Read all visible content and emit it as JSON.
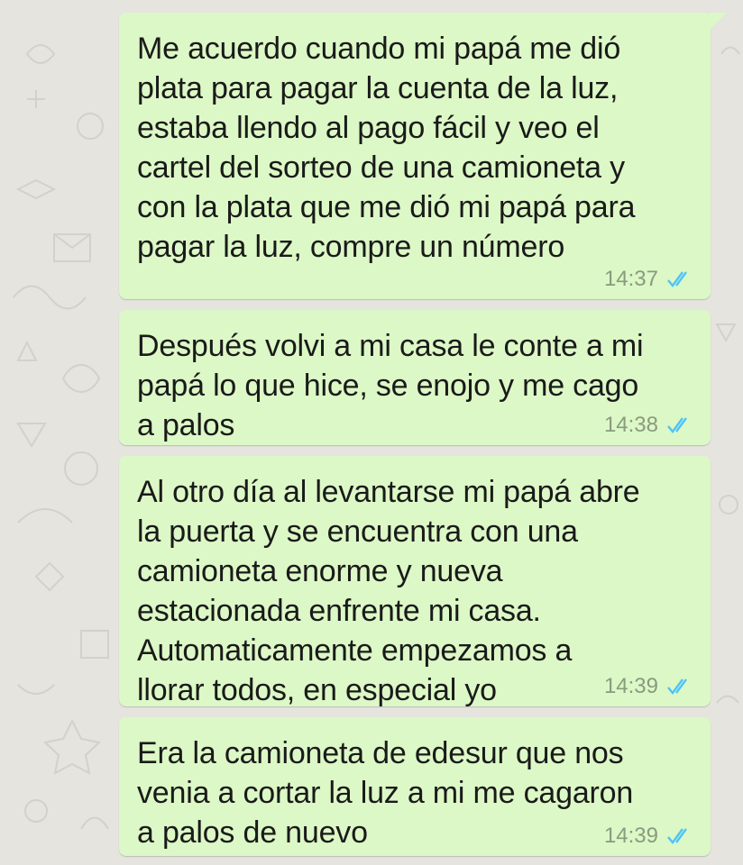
{
  "theme": {
    "background": "#e5e4df",
    "bubble_color": "#dcf8c6",
    "text_color": "#1a1a1a",
    "time_color": "#8a9a80",
    "read_tick_color": "#4fc3f7"
  },
  "messages": [
    {
      "text": "Me acuerdo cuando mi papá me dió\nplata para pagar la cuenta de la luz,\nestaba llendo al pago fácil y veo el\ncartel del sorteo de una camioneta y\ncon la plata que me dió mi papá para\npagar la luz, compre un número",
      "time": "14:37",
      "status_icon": "double-check-read-icon"
    },
    {
      "text": "Después volvi a mi casa le conte a mi\npapá lo que hice, se enojo y me cago\na palos",
      "time": "14:38",
      "status_icon": "double-check-read-icon"
    },
    {
      "text": "Al otro día al levantarse mi papá abre\nla puerta y se encuentra con una\ncamioneta enorme y nueva\nestacionada enfrente mi casa.\nAutomaticamente empezamos a\nllorar todos, en especial yo",
      "time": "14:39",
      "status_icon": "double-check-read-icon"
    },
    {
      "text": "Era la camioneta de edesur que nos\nvenia a cortar la luz a mi me cagaron\na palos de nuevo",
      "time": "14:39",
      "status_icon": "double-check-read-icon"
    }
  ]
}
